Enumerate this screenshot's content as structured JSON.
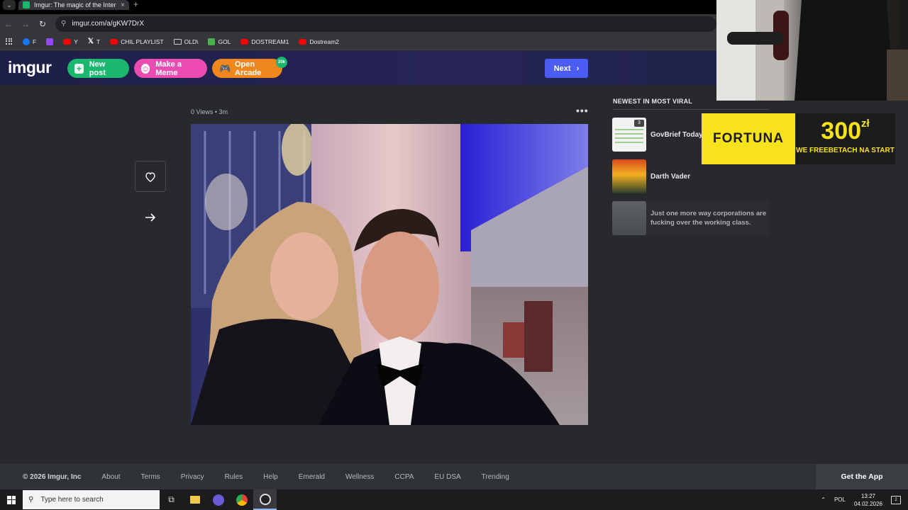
{
  "browser": {
    "tab_title": "Imgur: The magic of the Internet",
    "tab_close": "×",
    "new_tab": "+",
    "url": "imgur.com/a/gKW7DrX",
    "bookmarks": [
      {
        "label": "F",
        "icon": "facebook-icon"
      },
      {
        "label": "",
        "icon": "twitch-icon"
      },
      {
        "label": "Y",
        "icon": "youtube-icon"
      },
      {
        "label": "T",
        "icon": "x-icon"
      },
      {
        "label": "CHIL PLAYLIST",
        "icon": "youtube-icon"
      },
      {
        "label": "OLD\\",
        "icon": "folder-icon"
      },
      {
        "label": "GOL",
        "icon": "gol-icon"
      },
      {
        "label": "DOSTREAM1",
        "icon": "youtube-icon"
      },
      {
        "label": "Dostream2",
        "icon": "youtube-icon"
      }
    ]
  },
  "header": {
    "logo": "imgur",
    "new_post": "New post",
    "make_meme": "Make a Meme",
    "open_arcade": "Open Arcade",
    "arcade_badge": "20k",
    "next": "Next"
  },
  "post": {
    "views": "0 Views",
    "separator": "•",
    "age": "3m",
    "more": "•••"
  },
  "sidebar": {
    "title": "NEWEST IN MOST VIRAL",
    "items": [
      {
        "title": "GovBrief Today",
        "count": "3"
      },
      {
        "title": "Darth Vader"
      },
      {
        "title": "Just one more way corporations are fucking over the working class."
      }
    ]
  },
  "ad": {
    "brand": "FORTUNA",
    "amount": "300",
    "currency": "zł",
    "tagline": "WE FREEBETACH NA START"
  },
  "footer": {
    "copyright": "© 2026 Imgur, Inc",
    "links": [
      "About",
      "Terms",
      "Privacy",
      "Rules",
      "Help",
      "Emerald",
      "Wellness",
      "CCPA",
      "EU DSA",
      "Trending"
    ],
    "get_app": "Get the App"
  },
  "taskbar": {
    "search_placeholder": "Type here to search",
    "language": "POL",
    "time": "13:27",
    "date": "04.02.2026",
    "notifications": "2"
  }
}
